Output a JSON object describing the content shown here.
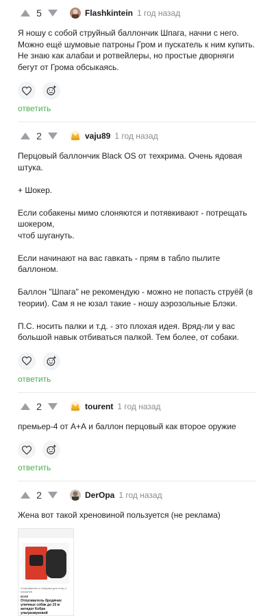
{
  "comments": [
    {
      "score": "5",
      "author": "Flashkintein",
      "time": "1 год назад",
      "text": "Я ношу с собой струйный баллончик Шпага, начни с него. Можно ещё шумовые патроны Гром и пускатель к ним купить. Не знаю как алабаи и ротвейлеры, но простые дворняги бегут от Грома обсыкаясь.",
      "reply": "ответить"
    },
    {
      "score": "2",
      "author": "vaju89",
      "time": "1 год назад",
      "text": "Перцовый баллончик Black OS от техкрима. Очень ядовая штука.\n\n+ Шокер.\n\nЕсли собакены мимо слоняются и потявкивают - потрещать шокером,\nчтоб шугануть.\n\nЕсли начинают на вас гавкать - прям в табло пылите баллоном.\n\nБаллон \"Шпага\" не рекомендую - можно не попасть струёй (в теории). Сам я не юзал такие - ношу аэрозольные Блэки.\n\nП.С. носить палки и т.д. - это плохая идея. Вряд-ли у вас большой навык отбиваться палкой. Тем более, от собаки.",
      "reply": "ответить"
    },
    {
      "score": "2",
      "author": "tourent",
      "time": "1 год назад",
      "text": "премьер-4 от А+А и баллон перцовый как второе оружие",
      "reply": "ответить"
    },
    {
      "score": "2",
      "author": "DerOpa",
      "time": "1 год назад",
      "text": "Жена вот такой хреновиной пользуется (не реклама)",
      "thumb": {
        "caption": "Отпугиватели и ловушки для птиц и грызунов",
        "brand": "BOSE",
        "title": "Отпугиватель бродячих уличных собак до 15 м антидог Кобра ультразвуковой"
      }
    }
  ],
  "colors": {
    "reply": "#4cae4c",
    "arrow": "#9aa0a6",
    "action_bg": "#f2f3f5"
  }
}
